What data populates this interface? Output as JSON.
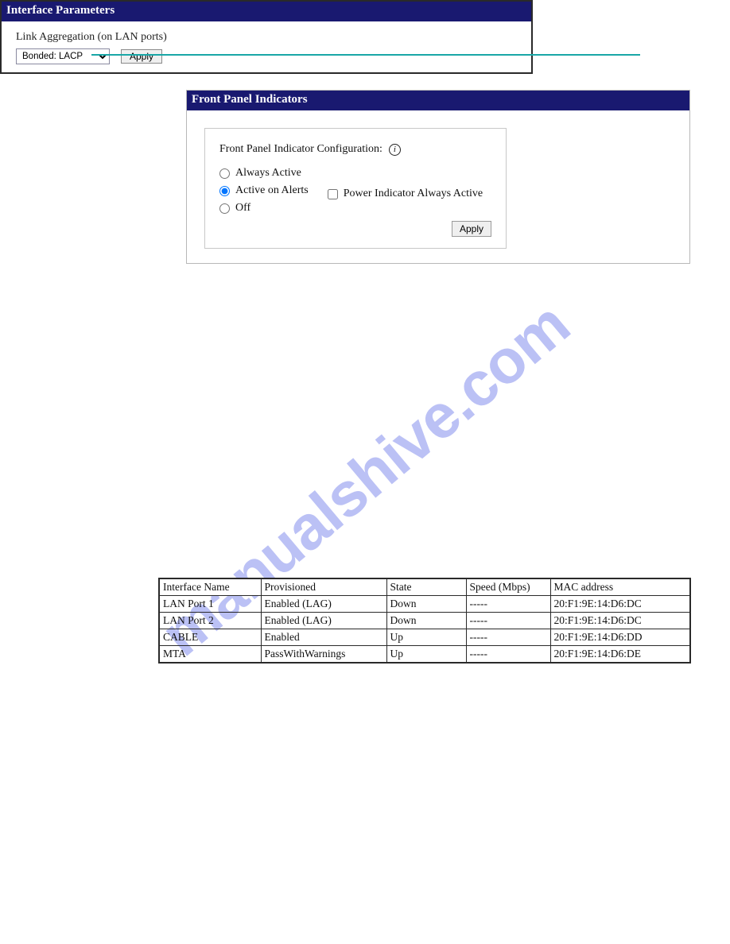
{
  "top_rule": true,
  "watermark_text": "manualshive.com",
  "panel1": {
    "title": "Front Panel Indicators",
    "config_label": "Front Panel Indicator Configuration:",
    "info_icon_glyph": "i",
    "options": {
      "always_active": "Always Active",
      "active_on_alerts": "Active on Alerts",
      "off": "Off"
    },
    "selected_option": "active_on_alerts",
    "power_checkbox": {
      "label": "Power Indicator Always Active",
      "checked": false
    },
    "apply_label": "Apply"
  },
  "panel2": {
    "title": "Interface Parameters",
    "body_label": "Link Aggregation (on LAN ports)",
    "select_value": "Bonded: LACP",
    "apply_label": "Apply"
  },
  "iface_table": {
    "headers": {
      "iname": "Interface Name",
      "prov": "Provisioned",
      "state": "State",
      "speed": "Speed (Mbps)",
      "mac": "MAC address"
    },
    "rows": [
      {
        "iname": "LAN Port 1",
        "prov": "Enabled (LAG)",
        "state": "Down",
        "speed": "-----",
        "mac": "20:F1:9E:14:D6:DC"
      },
      {
        "iname": "LAN Port 2",
        "prov": "Enabled (LAG)",
        "state": "Down",
        "speed": "-----",
        "mac": "20:F1:9E:14:D6:DC"
      },
      {
        "iname": "CABLE",
        "prov": "Enabled",
        "state": "Up",
        "speed": "-----",
        "mac": "20:F1:9E:14:D6:DD"
      },
      {
        "iname": "MTA",
        "prov": "PassWithWarnings",
        "state": "Up",
        "speed": "-----",
        "mac": "20:F1:9E:14:D6:DE"
      }
    ]
  }
}
